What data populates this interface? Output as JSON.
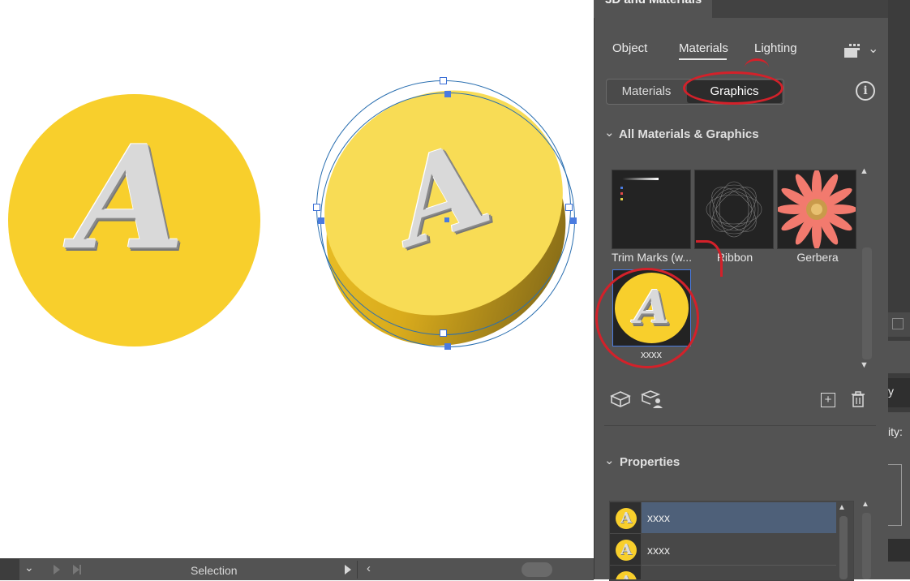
{
  "panel": {
    "title": "3D and Materials",
    "tabs": [
      "Object",
      "Materials",
      "Lighting"
    ],
    "active_tab": "Materials",
    "segmented": [
      "Materials",
      "Graphics"
    ],
    "active_segment": "Graphics",
    "section_all": "All Materials & Graphics",
    "graphics": [
      {
        "label": "Trim Marks (w..."
      },
      {
        "label": "Ribbon"
      },
      {
        "label": "Gerbera"
      },
      {
        "label": "xxxx"
      }
    ],
    "section_properties": "Properties",
    "properties_rows": [
      {
        "name": "xxxx"
      },
      {
        "name": "xxxx"
      }
    ],
    "side_labels": [
      "y",
      "ity:"
    ]
  },
  "canvas": {
    "letter": "A"
  },
  "status_bar": {
    "tool": "Selection"
  },
  "colors": {
    "accent_yellow": "#f8cf2c",
    "panel_bg": "#535353",
    "selected_row": "#4e6079",
    "annotation_red": "#d3212a"
  }
}
